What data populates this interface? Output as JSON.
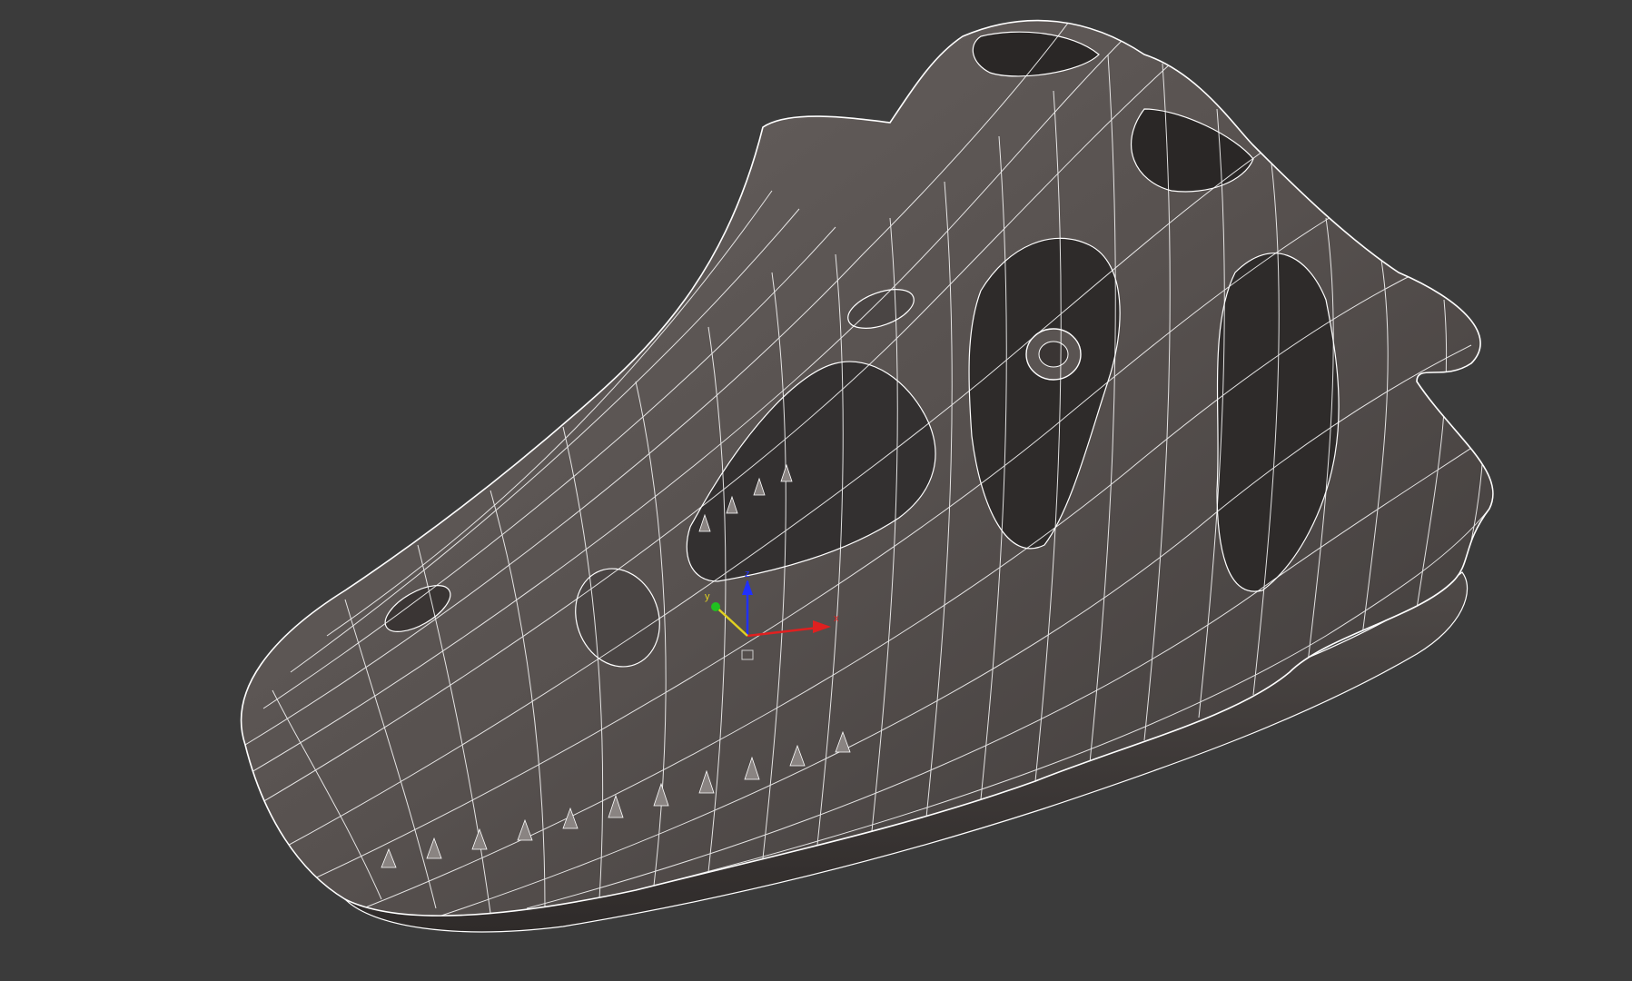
{
  "viewport": {
    "background": "#3b3b3b",
    "model_fill": "#5a5452",
    "model_shadow": "#2a2726",
    "wire_color": "#ffffff",
    "model_icon": "dinosaur-skull-wireframe"
  },
  "gizmo": {
    "axes": [
      {
        "axis": "x",
        "label": "x",
        "color": "#e02020"
      },
      {
        "axis": "y",
        "label": "y",
        "color": "#e0d020"
      },
      {
        "axis": "z",
        "label": "z",
        "color": "#2030ff"
      }
    ]
  }
}
